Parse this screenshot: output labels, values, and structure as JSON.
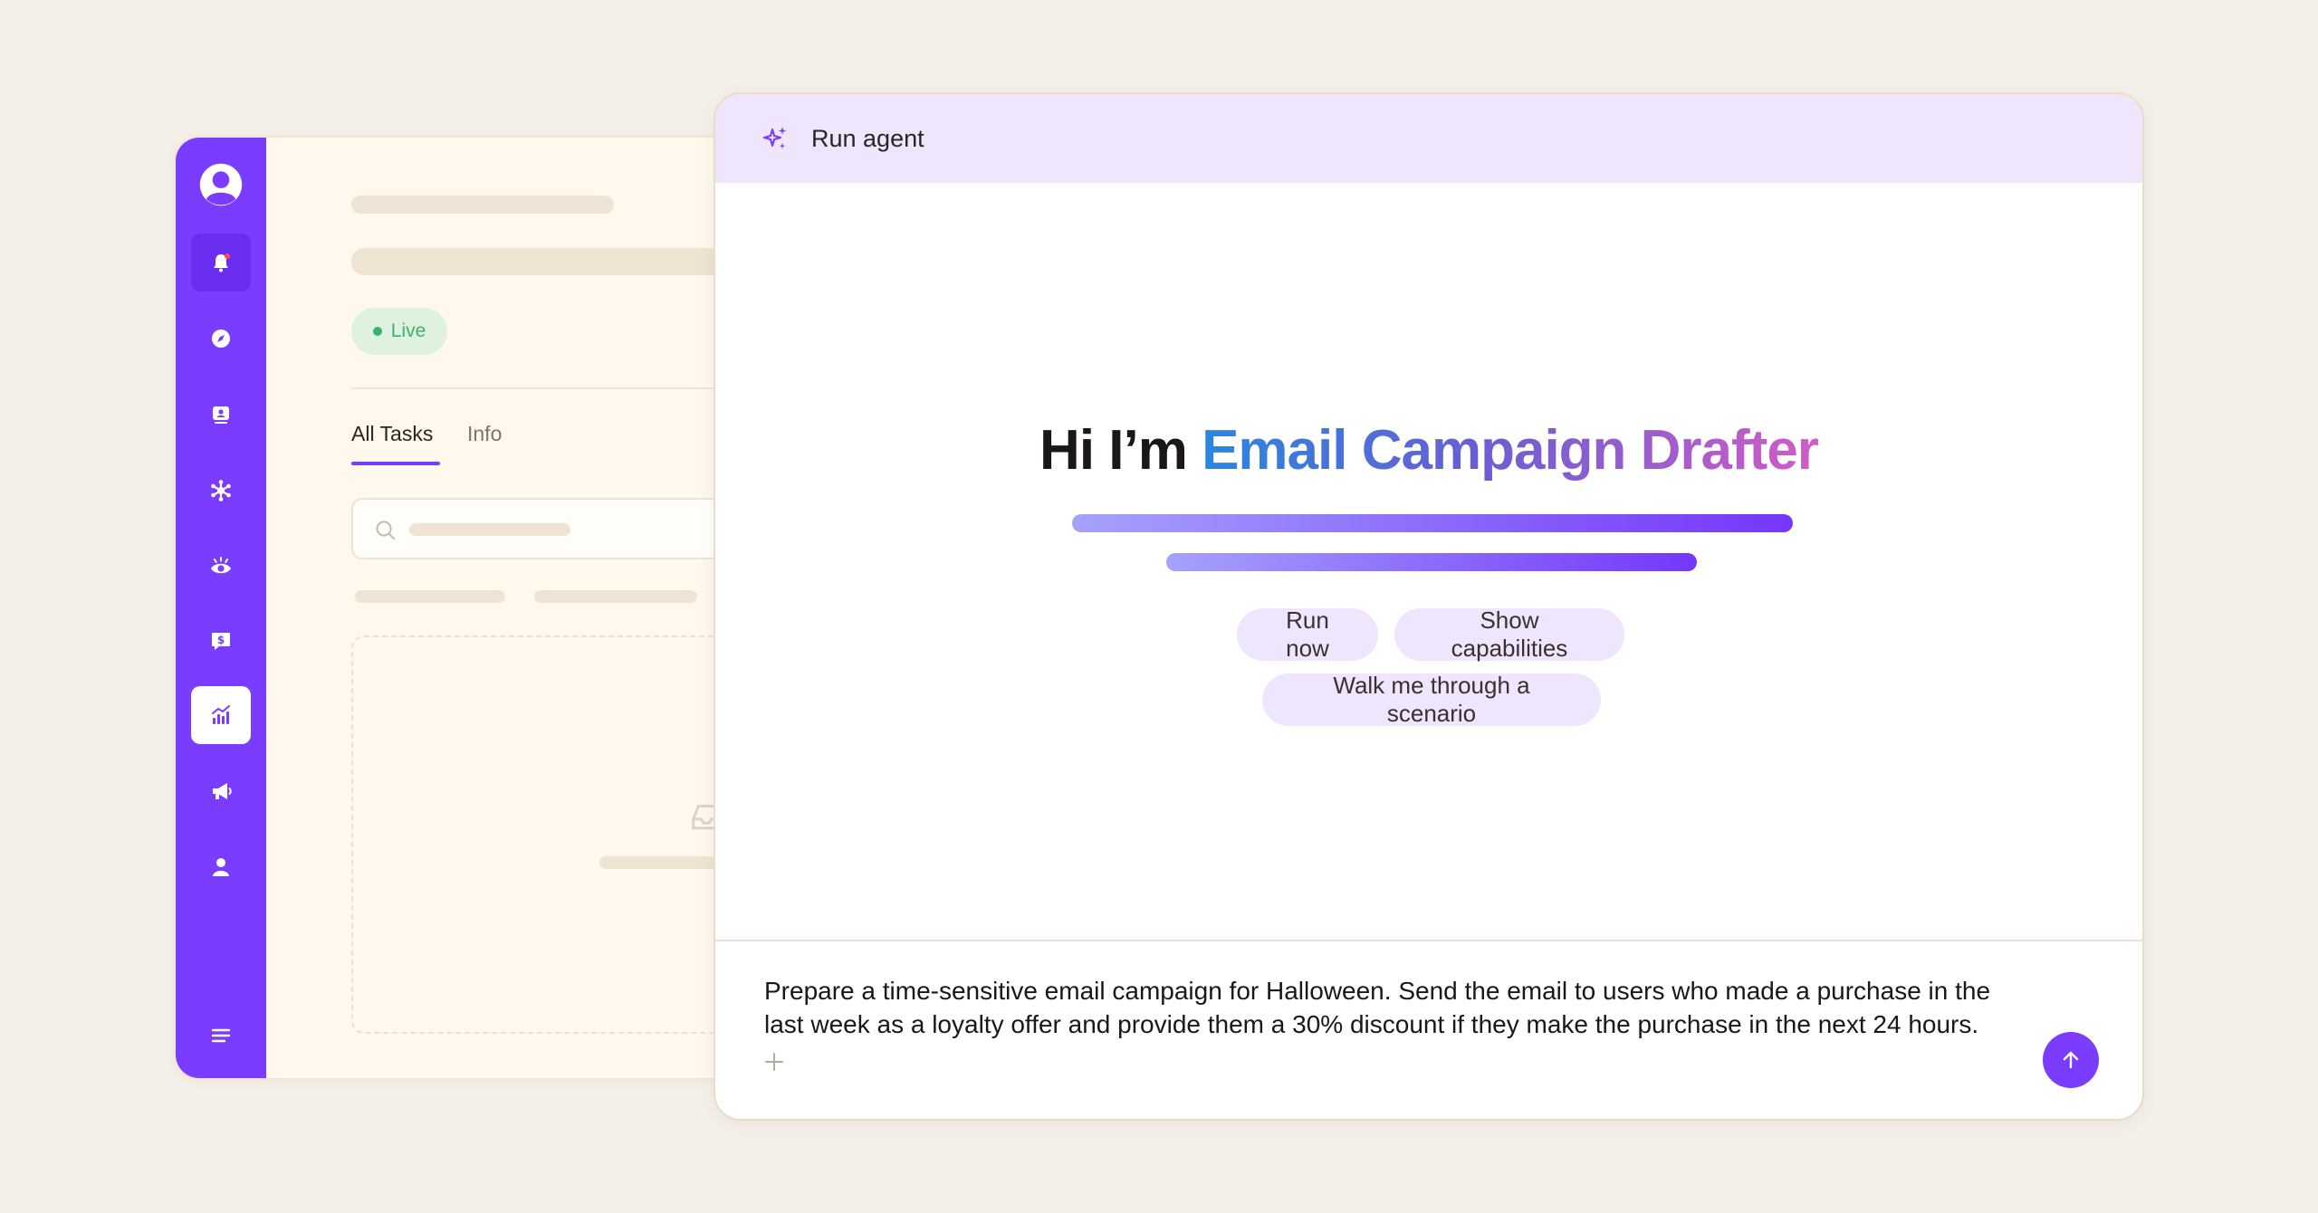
{
  "background_color": "#f4efe8",
  "accent_color": "#7a3cff",
  "sidebar": {
    "items": [
      {
        "icon": "user-circle-icon"
      },
      {
        "icon": "bell-icon",
        "state": "active-dark",
        "has_notification_dot": true
      },
      {
        "icon": "compass-icon"
      },
      {
        "icon": "contact-card-icon"
      },
      {
        "icon": "network-icon"
      },
      {
        "icon": "eye-icon"
      },
      {
        "icon": "dollar-chat-icon"
      },
      {
        "icon": "analytics-chart-icon",
        "state": "selected"
      },
      {
        "icon": "megaphone-icon"
      },
      {
        "icon": "person-icon"
      },
      {
        "icon": "menu-icon"
      }
    ]
  },
  "back_app": {
    "status_label": "Live",
    "tabs": [
      {
        "label": "All Tasks",
        "active": true
      },
      {
        "label": "Info",
        "active": false
      }
    ]
  },
  "agent": {
    "header_title": "Run agent",
    "greeting_prefix": "Hi I’m ",
    "agent_name": "Email Campaign Drafter",
    "chips": [
      "Run now",
      "Show capabilities",
      "Walk me through a scenario"
    ],
    "prompt_text": "Prepare a time-sensitive email campaign for Halloween. Send the email to users who made a purchase in the last week as a loyalty offer and provide them a 30% discount if they make the purchase in the next 24 hours.",
    "gradient_colors": [
      "#2a86e0",
      "#6a5ed2",
      "#d05cc8"
    ]
  }
}
